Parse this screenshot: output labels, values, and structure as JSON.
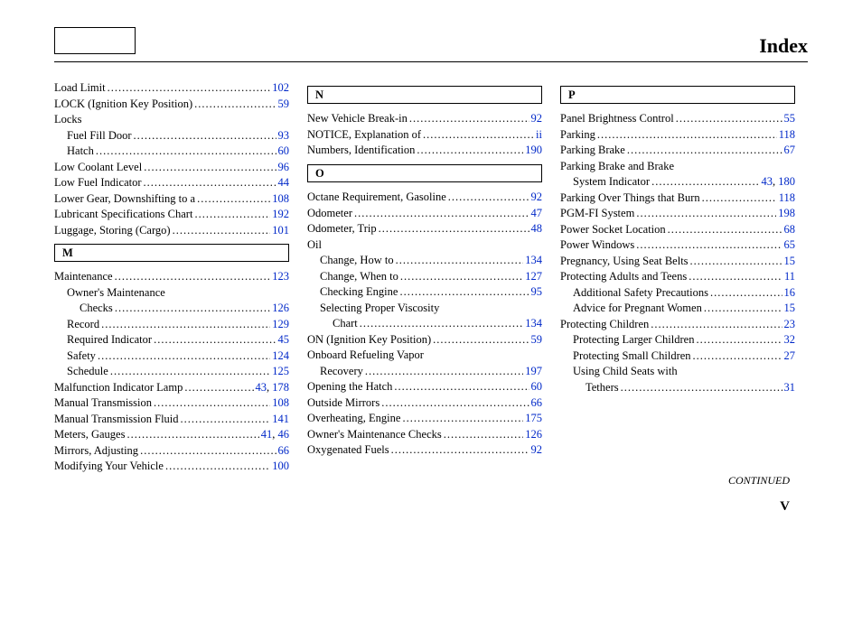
{
  "header": {
    "title": "Index"
  },
  "footer": {
    "continued": "CONTINUED",
    "page": "V"
  },
  "columns": [
    {
      "groups": [
        {
          "letter": null,
          "entries": [
            {
              "label": "Load Limit",
              "pages": [
                "102"
              ],
              "indent": 0
            },
            {
              "label": "LOCK (Ignition Key Position)",
              "pages": [
                "59"
              ],
              "indent": 0
            },
            {
              "label": "Locks",
              "pages": [],
              "indent": 0,
              "nodots": true
            },
            {
              "label": "Fuel Fill Door",
              "pages": [
                "93"
              ],
              "indent": 1
            },
            {
              "label": "Hatch",
              "pages": [
                "60"
              ],
              "indent": 1
            },
            {
              "label": "Low Coolant Level",
              "pages": [
                "96"
              ],
              "indent": 0
            },
            {
              "label": "Low Fuel Indicator",
              "pages": [
                "44"
              ],
              "indent": 0
            },
            {
              "label": "Lower Gear, Downshifting to a",
              "pages": [
                "108"
              ],
              "indent": 0
            },
            {
              "label": "Lubricant Specifications Chart",
              "pages": [
                "192"
              ],
              "indent": 0
            },
            {
              "label": "Luggage, Storing (Cargo)",
              "pages": [
                "101"
              ],
              "indent": 0
            }
          ]
        },
        {
          "letter": "M",
          "entries": [
            {
              "label": "Maintenance",
              "pages": [
                "123"
              ],
              "indent": 0
            },
            {
              "label": "Owner's Maintenance",
              "pages": [],
              "indent": 1,
              "nodots": true
            },
            {
              "label": "Checks",
              "pages": [
                "126"
              ],
              "indent": 2
            },
            {
              "label": "Record",
              "pages": [
                "129"
              ],
              "indent": 1
            },
            {
              "label": "Required Indicator",
              "pages": [
                "45"
              ],
              "indent": 1
            },
            {
              "label": "Safety",
              "pages": [
                "124"
              ],
              "indent": 1
            },
            {
              "label": "Schedule",
              "pages": [
                "125"
              ],
              "indent": 1
            },
            {
              "label": "Malfunction Indicator Lamp",
              "pages": [
                "43",
                "178"
              ],
              "indent": 0
            },
            {
              "label": "Manual Transmission",
              "pages": [
                "108"
              ],
              "indent": 0
            },
            {
              "label": "Manual Transmission Fluid",
              "pages": [
                "141"
              ],
              "indent": 0
            },
            {
              "label": "Meters, Gauges",
              "pages": [
                "41",
                "46"
              ],
              "indent": 0
            },
            {
              "label": "Mirrors, Adjusting",
              "pages": [
                "66"
              ],
              "indent": 0
            },
            {
              "label": "Modifying Your Vehicle",
              "pages": [
                "100"
              ],
              "indent": 0
            }
          ]
        }
      ]
    },
    {
      "groups": [
        {
          "letter": "N",
          "entries": [
            {
              "label": "New Vehicle Break-in",
              "pages": [
                "92"
              ],
              "indent": 0
            },
            {
              "label": "NOTICE, Explanation of",
              "pages": [
                "ii"
              ],
              "indent": 0
            },
            {
              "label": "Numbers, Identification",
              "pages": [
                "190"
              ],
              "indent": 0
            }
          ]
        },
        {
          "letter": "O",
          "entries": [
            {
              "label": "Octane Requirement, Gasoline",
              "pages": [
                "92"
              ],
              "indent": 0
            },
            {
              "label": "Odometer",
              "pages": [
                "47"
              ],
              "indent": 0
            },
            {
              "label": "Odometer, Trip",
              "pages": [
                "48"
              ],
              "indent": 0
            },
            {
              "label": "Oil",
              "pages": [],
              "indent": 0,
              "nodots": true
            },
            {
              "label": "Change, How to",
              "pages": [
                "134"
              ],
              "indent": 1
            },
            {
              "label": "Change, When to",
              "pages": [
                "127"
              ],
              "indent": 1
            },
            {
              "label": "Checking Engine",
              "pages": [
                "95"
              ],
              "indent": 1
            },
            {
              "label": "Selecting Proper Viscosity",
              "pages": [],
              "indent": 1,
              "nodots": true
            },
            {
              "label": "Chart",
              "pages": [
                "134"
              ],
              "indent": 2
            },
            {
              "label": "ON (Ignition Key Position)",
              "pages": [
                "59"
              ],
              "indent": 0
            },
            {
              "label": "Onboard Refueling Vapor",
              "pages": [],
              "indent": 0,
              "nodots": true
            },
            {
              "label": "Recovery",
              "pages": [
                "197"
              ],
              "indent": 1
            },
            {
              "label": "Opening the Hatch",
              "pages": [
                "60"
              ],
              "indent": 0
            },
            {
              "label": "Outside Mirrors",
              "pages": [
                "66"
              ],
              "indent": 0
            },
            {
              "label": "Overheating, Engine",
              "pages": [
                "175"
              ],
              "indent": 0
            },
            {
              "label": "Owner's Maintenance Checks",
              "pages": [
                "126"
              ],
              "indent": 0
            },
            {
              "label": "Oxygenated Fuels",
              "pages": [
                "92"
              ],
              "indent": 0
            }
          ]
        }
      ]
    },
    {
      "groups": [
        {
          "letter": "P",
          "entries": [
            {
              "label": "Panel Brightness Control",
              "pages": [
                "55"
              ],
              "indent": 0
            },
            {
              "label": "Parking",
              "pages": [
                "118"
              ],
              "indent": 0
            },
            {
              "label": "Parking Brake",
              "pages": [
                "67"
              ],
              "indent": 0
            },
            {
              "label": "Parking Brake and Brake",
              "pages": [],
              "indent": 0,
              "nodots": true
            },
            {
              "label": "System Indicator",
              "pages": [
                "43",
                "180"
              ],
              "indent": 1
            },
            {
              "label": "Parking Over Things that Burn",
              "pages": [
                "118"
              ],
              "indent": 0
            },
            {
              "label": "PGM-FI System",
              "pages": [
                "198"
              ],
              "indent": 0
            },
            {
              "label": "Power Socket Location",
              "pages": [
                "68"
              ],
              "indent": 0
            },
            {
              "label": "Power Windows",
              "pages": [
                "65"
              ],
              "indent": 0
            },
            {
              "label": "Pregnancy, Using Seat Belts",
              "pages": [
                "15"
              ],
              "indent": 0
            },
            {
              "label": "Protecting Adults and Teens",
              "pages": [
                "11"
              ],
              "indent": 0
            },
            {
              "label": "Additional Safety Precautions",
              "pages": [
                "16"
              ],
              "indent": 1
            },
            {
              "label": "Advice for Pregnant Women",
              "pages": [
                "15"
              ],
              "indent": 1
            },
            {
              "label": "Protecting Children",
              "pages": [
                "23"
              ],
              "indent": 0
            },
            {
              "label": "Protecting Larger Children",
              "pages": [
                "32"
              ],
              "indent": 1
            },
            {
              "label": "Protecting Small Children",
              "pages": [
                "27"
              ],
              "indent": 1
            },
            {
              "label": "Using Child Seats with",
              "pages": [],
              "indent": 1,
              "nodots": true
            },
            {
              "label": "Tethers",
              "pages": [
                "31"
              ],
              "indent": 2
            }
          ]
        }
      ]
    }
  ]
}
